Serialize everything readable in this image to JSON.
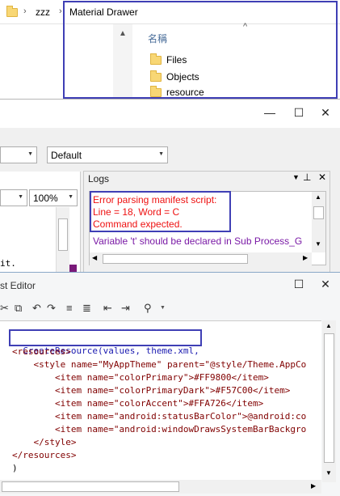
{
  "explorer": {
    "breadcrumb": [
      "zzz",
      "Material Drawer"
    ],
    "breadcrumb_sep": "›",
    "column_name": "名稱",
    "sort_indicator": "^",
    "items": [
      {
        "label": "Files",
        "icon": "folder-icon"
      },
      {
        "label": "Objects",
        "icon": "folder-icon"
      },
      {
        "label": "resource",
        "icon": "folder-icon"
      }
    ],
    "highlight_color": "#3f3fb5"
  },
  "mid_window": {
    "controls": {
      "close": "✕",
      "maximize": "☐",
      "minimize": "—"
    },
    "toolbar": {
      "style_value": "Default",
      "zoom_value": "100%"
    },
    "left_text": "it.",
    "logs": {
      "title": "Logs",
      "pin_icon": "pin-icon",
      "error_lines": [
        "Error parsing manifest script:",
        "Line = 18, Word = C",
        "Command expected."
      ],
      "warning": "Variable 't' should be declared in Sub Process_G",
      "error_color": "#e11111",
      "warning_color": "#7a1aa6"
    }
  },
  "editor": {
    "title": "st Editor",
    "controls": {
      "maximize": "☐",
      "close": "✕"
    },
    "code": [
      "CreateResource(values, theme.xml,",
      "<resources>",
      "    <style name=\"MyAppTheme\" parent=\"@style/Theme.AppCo",
      "        <item name=\"colorPrimary\">#FF9800</item>",
      "        <item name=\"colorPrimaryDark\">#F57C00</item>",
      "        <item name=\"colorAccent\">#FFA726</item>",
      "        <item name=\"android:statusBarColor\">@android:co",
      "        <item name=\"android:windowDrawsSystemBarBackgro",
      "    </style>",
      "</resources>",
      ")"
    ]
  }
}
